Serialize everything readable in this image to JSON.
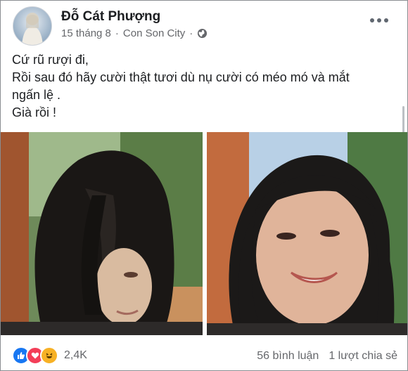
{
  "post": {
    "author": "Đỗ Cát Phượng",
    "date": "15 tháng 8",
    "separator": "·",
    "location": "Con Son City",
    "privacy_icon": "globe-icon",
    "more_icon": "more-options-icon",
    "text_lines": [
      "Cứ rũ rượi đi,",
      "Rồi sau đó hãy cười thật tươi dù nụ cười có méo mó và mắt",
      "ngấn lệ .",
      "Già rồi !"
    ]
  },
  "footer": {
    "reaction_icons": [
      "like-icon",
      "love-icon",
      "haha-icon"
    ],
    "reaction_count": "2,4K",
    "comments": "56 bình luận",
    "shares": "1 lượt chia sẻ"
  },
  "colors": {
    "like": "#1877f2",
    "love": "#f33e58",
    "haha": "#f7b125",
    "secondary_text": "#65676b"
  }
}
